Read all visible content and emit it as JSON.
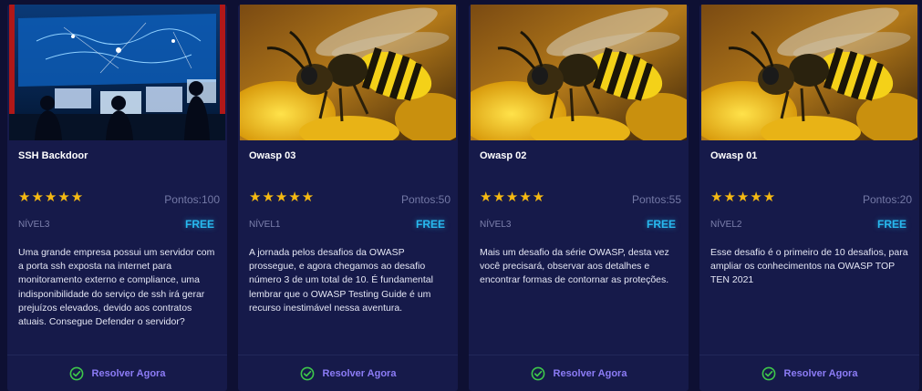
{
  "cards": [
    {
      "image": "control-room-image",
      "title": "SSH Backdoor",
      "stars": "★★★★★",
      "rating": 5,
      "points": "Pontos:100",
      "level": "NÍVEL3",
      "badge": "FREE",
      "description": "Uma grande empresa possui um servidor com a porta ssh exposta na internet para monitoramento externo e compliance, uma indisponibilidade do serviço de ssh irá gerar prejuízos elevados, devido aos contratos atuais. Consegue Defender o servidor?",
      "action": "Resolver Agora"
    },
    {
      "image": "wasp-image",
      "title": "Owasp 03",
      "stars": "★★★★★",
      "rating": 5,
      "points": "Pontos:50",
      "level": "NÍVEL1",
      "badge": "FREE",
      "description": "A jornada pelos desafios da OWASP prossegue, e agora chegamos ao desafio número 3 de um total de 10. É fundamental lembrar que o OWASP Testing Guide é um recurso inestimável nessa aventura.",
      "action": "Resolver Agora"
    },
    {
      "image": "wasp-image",
      "title": "Owasp 02",
      "stars": "★★★★★",
      "rating": 5,
      "points": "Pontos:55",
      "level": "NÍVEL3",
      "badge": "FREE",
      "description": "Mais um desafio da série OWASP, desta vez você precisará, observar aos detalhes e encontrar formas de contornar as proteções.",
      "action": "Resolver Agora"
    },
    {
      "image": "wasp-image",
      "title": "Owasp 01",
      "stars": "★★★★★",
      "rating": 5,
      "points": "Pontos:20",
      "level": "NÍVEL2",
      "badge": "FREE",
      "description": "Esse desafio é o primeiro de 10 desafios, para ampliar os conhecimentos na OWASP TOP TEN 2021",
      "action": "Resolver Agora"
    }
  ],
  "colors": {
    "background": "#0e1033",
    "card": "#161a4a",
    "star": "#f5b913",
    "badge": "#28b9ef",
    "action": "#8c7cf6",
    "check": "#3ec84a"
  }
}
